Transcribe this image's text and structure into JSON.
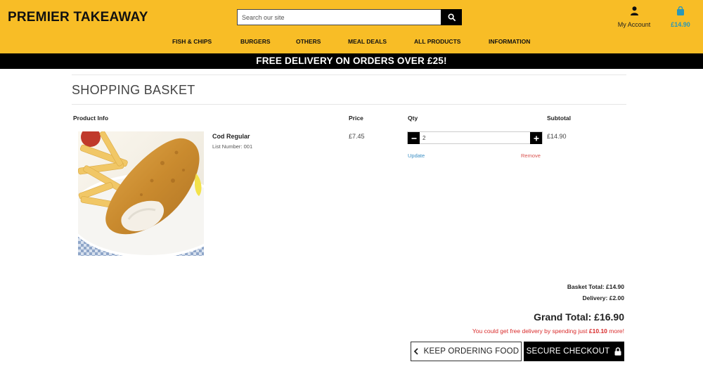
{
  "header": {
    "brand": "PREMIER TAKEAWAY",
    "search_placeholder": "Search our site",
    "account_label": "My Account",
    "cart_total": "£14.90"
  },
  "nav": {
    "items": [
      "FISH & CHIPS",
      "BURGERS",
      "OTHERS",
      "MEAL DEALS",
      "ALL PRODUCTS",
      "INFORMATION"
    ]
  },
  "promo": "FREE DELIVERY ON ORDERS OVER £25!",
  "basket": {
    "title": "SHOPPING BASKET",
    "columns": {
      "product": "Product Info",
      "price": "Price",
      "qty": "Qty",
      "subtotal": "Subtotal"
    },
    "item": {
      "name": "Cod Regular",
      "list_number": "List Number: 001",
      "price": "£7.45",
      "qty": "2",
      "subtotal": "£14.90",
      "update_label": "Update",
      "remove_label": "Remove",
      "image_icon": "fish-and-chips-photo"
    }
  },
  "totals": {
    "basket_total": "Basket Total: £14.90",
    "delivery": "Delivery: £2.00",
    "grand_total": "Grand Total: £16.90",
    "free_msg_prefix": "You could get free delivery by spending just ",
    "free_msg_amount": "£10.10",
    "free_msg_suffix": " more!"
  },
  "actions": {
    "keep_ordering": "KEEP ORDERING FOOD",
    "checkout": "SECURE CHECKOUT"
  },
  "colors": {
    "header_bg": "#f8bd26",
    "accent_blue": "#2a98b8",
    "alert_red": "#d92b2b"
  }
}
